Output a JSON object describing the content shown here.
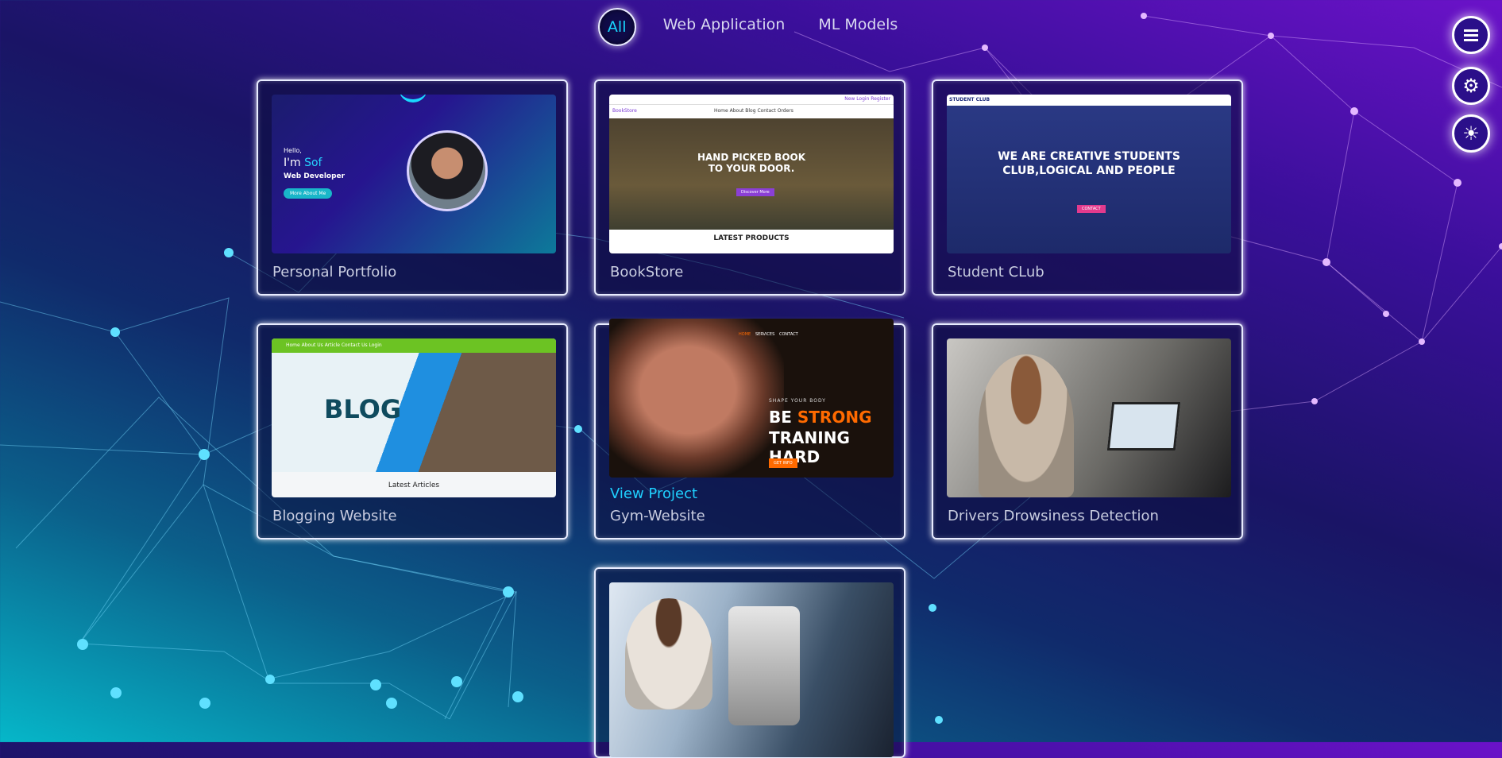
{
  "filters": [
    {
      "label": "All",
      "active": true
    },
    {
      "label": "Web Application",
      "active": false
    },
    {
      "label": "ML Models",
      "active": false
    }
  ],
  "fabs": [
    {
      "icon": "menu-icon"
    },
    {
      "icon": "gear-icon"
    },
    {
      "icon": "sun-icon"
    }
  ],
  "projects": [
    {
      "title": "Personal Portfolio",
      "thumb": {
        "line1": "Hello,",
        "line2a": "I'm ",
        "line2b": "Sof",
        "line3": "Web Developer",
        "button": "More About Me"
      }
    },
    {
      "title": "BookStore",
      "thumb": {
        "brand": "BookStore",
        "nav": "Home  About  Blog  Contact  Orders",
        "links": "New  Login  Register",
        "headline1": "HAND PICKED BOOK",
        "headline2": "TO YOUR DOOR.",
        "cta": "Discover More",
        "section": "LATEST PRODUCTS"
      }
    },
    {
      "title": "Student CLub",
      "thumb": {
        "brand": "STUDENT CLUB",
        "headline1": "WE ARE CREATIVE STUDENTS",
        "headline2": "CLUB,LOGICAL AND PEOPLE",
        "cta": "CONTACT"
      }
    },
    {
      "title": "Blogging Website",
      "thumb": {
        "nav": "Home  About Us  Article  Contact Us  Login",
        "hero": "BLOG",
        "caption": "Latest Articles"
      }
    },
    {
      "title": "Gym-Website",
      "view_label": "View Project",
      "thumb": {
        "nav1": "HOME",
        "nav2": "SERVICES",
        "nav3": "CONTACT",
        "tagline": "SHAPE YOUR BODY",
        "h1a": "BE ",
        "h1b": "STRONG",
        "h2": "TRANING HARD",
        "cta": "GET INFO"
      }
    },
    {
      "title": "Drivers Drowsiness Detection",
      "thumb": {}
    },
    {
      "title": "",
      "thumb": {}
    }
  ],
  "colors": {
    "accent": "#19d8ff",
    "gym_orange": "#ff6a00",
    "blog_green": "#6cc323"
  }
}
